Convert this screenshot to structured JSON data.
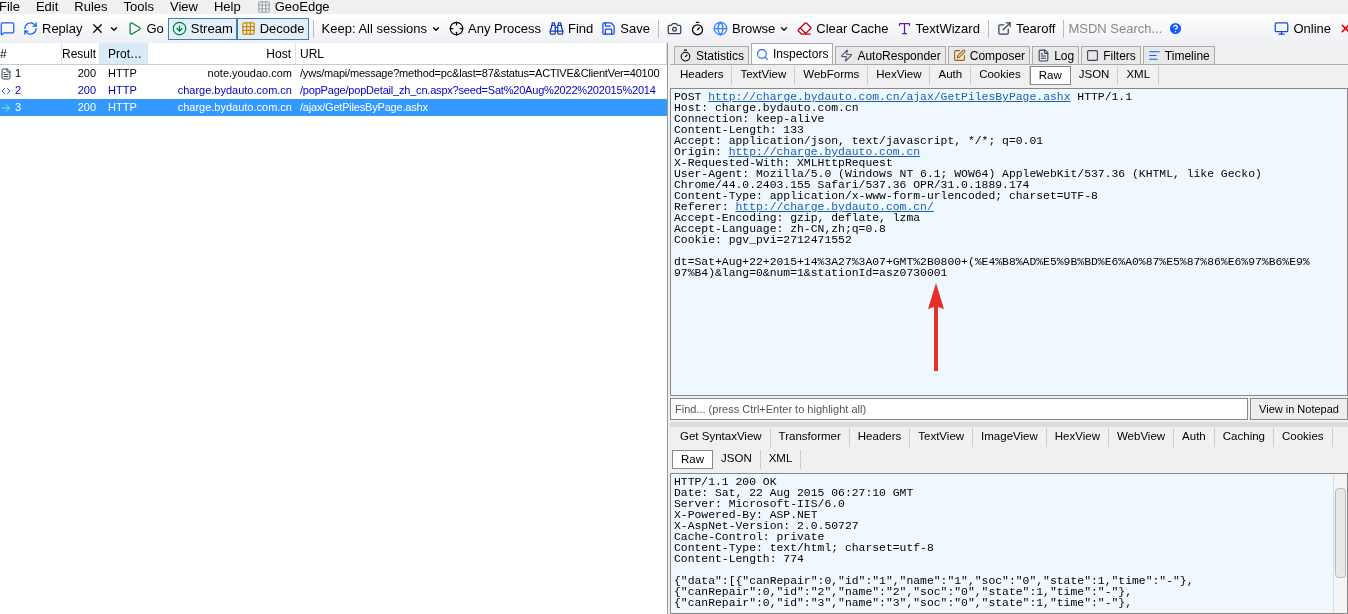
{
  "menu": [
    "File",
    "Edit",
    "Rules",
    "Tools",
    "View",
    "Help",
    "GeoEdge"
  ],
  "toolbar": [
    {
      "kind": "comment",
      "pressed": false
    },
    {
      "kind": "replay",
      "label": "Replay",
      "pressed": false
    },
    {
      "kind": "remove",
      "pressed": false
    },
    {
      "kind": "go",
      "label": "Go",
      "pressed": false
    },
    {
      "kind": "stream",
      "label": "Stream",
      "pressed": true
    },
    {
      "kind": "decode",
      "label": "Decode",
      "pressed": true
    },
    {
      "kind": "keep",
      "label": "Keep: All sessions",
      "pressed": false
    },
    {
      "kind": "process",
      "label": "Any Process",
      "pressed": false
    },
    {
      "kind": "find",
      "label": "Find",
      "pressed": false
    },
    {
      "kind": "save",
      "label": "Save",
      "pressed": false
    },
    {
      "kind": "camera",
      "pressed": false
    },
    {
      "kind": "timer",
      "pressed": false
    },
    {
      "kind": "browse",
      "label": "Browse",
      "pressed": false
    },
    {
      "kind": "clear",
      "label": "Clear Cache",
      "pressed": false
    },
    {
      "kind": "textwizard",
      "label": "TextWizard",
      "pressed": false
    },
    {
      "kind": "tearoff",
      "label": "Tearoff",
      "pressed": false
    }
  ],
  "msdn_search": {
    "placeholder": "MSDN Search..."
  },
  "online": "Online",
  "sessions": {
    "columns": [
      {
        "label": "#",
        "sorted": false
      },
      {
        "label": "Result",
        "sorted": false
      },
      {
        "label": "Prot…",
        "sorted": true
      },
      {
        "label": "Host",
        "sorted": false
      },
      {
        "label": "URL",
        "sorted": false
      }
    ],
    "rows": [
      {
        "kind": "document",
        "num": "1",
        "result": "200",
        "protocol": "HTTP",
        "host": "note.youdao.com",
        "url": "/yws/mapi/message?method=pc&last=87&status=ACTIVE&ClientVer=40100",
        "highlighted": false,
        "selected": false
      },
      {
        "kind": "arrows",
        "num": "2",
        "result": "200",
        "protocol": "HTTP",
        "host": "charge.bydauto.com.cn",
        "url": "/popPage/popDetail_zh_cn.aspx?seed=Sat%20Aug%2022%202015%2014",
        "highlighted": true,
        "selected": false
      },
      {
        "kind": "arrow",
        "num": "3",
        "result": "200",
        "protocol": "HTTP",
        "host": "charge.bydauto.com.cn",
        "url": "/ajax/GetPilesByPage.ashx",
        "highlighted": true,
        "selected": true
      }
    ]
  },
  "main_tabs": [
    {
      "kind": "statistics",
      "label": "Statistics",
      "selected": false
    },
    {
      "kind": "inspectors",
      "label": "Inspectors",
      "selected": true
    },
    {
      "kind": "autoresponder",
      "label": "AutoResponder",
      "selected": false
    },
    {
      "kind": "composer",
      "label": "Composer",
      "selected": false
    },
    {
      "kind": "log",
      "label": "Log",
      "selected": false
    },
    {
      "kind": "filters",
      "label": "Filters",
      "selected": false
    },
    {
      "kind": "timeline",
      "label": "Timeline",
      "selected": false
    }
  ],
  "request_tabs": [
    {
      "label": "Headers",
      "selected": false
    },
    {
      "label": "TextView",
      "selected": false
    },
    {
      "label": "WebForms",
      "selected": false
    },
    {
      "label": "HexView",
      "selected": false
    },
    {
      "label": "Auth",
      "selected": false
    },
    {
      "label": "Cookies",
      "selected": false
    },
    {
      "label": "Raw",
      "selected": true
    },
    {
      "label": "JSON",
      "selected": false
    },
    {
      "label": "XML",
      "selected": false
    }
  ],
  "request_lines": [
    [
      {
        "t": "POST "
      },
      {
        "t": "http://charge.bydauto.com.cn/ajax/GetPilesByPage.ashx",
        "link": true
      },
      {
        "t": " HTTP/1.1"
      }
    ],
    [
      {
        "t": "Host: charge.bydauto.com.cn"
      }
    ],
    [
      {
        "t": "Connection: keep-alive"
      }
    ],
    [
      {
        "t": "Content-Length: 133"
      }
    ],
    [
      {
        "t": "Accept: application/json, text/javascript, */*; q=0.01"
      }
    ],
    [
      {
        "t": "Origin: "
      },
      {
        "t": "http://charge.bydauto.com.cn",
        "link": true
      }
    ],
    [
      {
        "t": "X-Requested-With: XMLHttpRequest"
      }
    ],
    [
      {
        "t": "User-Agent: Mozilla/5.0 (Windows NT 6.1; WOW64) AppleWebKit/537.36 (KHTML, like Gecko)"
      }
    ],
    [
      {
        "t": "Chrome/44.0.2403.155 Safari/537.36 OPR/31.0.1889.174"
      }
    ],
    [
      {
        "t": "Content-Type: application/x-www-form-urlencoded; charset=UTF-8"
      }
    ],
    [
      {
        "t": "Referer: "
      },
      {
        "t": "http://charge.bydauto.com.cn/",
        "link": true
      }
    ],
    [
      {
        "t": "Accept-Encoding: gzip, deflate, lzma"
      }
    ],
    [
      {
        "t": "Accept-Language: zh-CN,zh;q=0.8"
      }
    ],
    [
      {
        "t": "Cookie: pgv_pvi=2712471552"
      }
    ]
  ],
  "request_body": [
    [
      {
        "t": "dt=Sat+Aug+22+2015+14%3A27%3A07+GMT%2B0800+(%E4%B8%AD%E5%9B%BD%E6%A0%87%E5%87%86%E6%97%B6%E9%"
      }
    ],
    [
      {
        "t": "97%B4)&lang=0&num=1&stationId=asz0730001"
      }
    ]
  ],
  "find": {
    "placeholder": "Find... (press Ctrl+Enter to highlight all)",
    "button": "View in Notepad"
  },
  "response_tabs": [
    {
      "label": "Get SyntaxView",
      "selected": false
    },
    {
      "label": "Transformer",
      "selected": false
    },
    {
      "label": "Headers",
      "selected": false
    },
    {
      "label": "TextView",
      "selected": false
    },
    {
      "label": "ImageView",
      "selected": false
    },
    {
      "label": "HexView",
      "selected": false
    },
    {
      "label": "WebView",
      "selected": false
    },
    {
      "label": "Auth",
      "selected": false
    },
    {
      "label": "Caching",
      "selected": false
    },
    {
      "label": "Cookies",
      "selected": false
    }
  ],
  "response_subtabs": [
    {
      "label": "Raw",
      "selected": true
    },
    {
      "label": "JSON",
      "selected": false
    },
    {
      "label": "XML",
      "selected": false
    }
  ],
  "response_lines": [
    "HTTP/1.1 200 OK",
    "Date: Sat, 22 Aug 2015 06:27:10 GMT",
    "Server: Microsoft-IIS/6.0",
    "X-Powered-By: ASP.NET",
    "X-AspNet-Version: 2.0.50727",
    "Cache-Control: private",
    "Content-Type: text/html; charset=utf-8",
    "Content-Length: 774"
  ],
  "response_body": [
    "{\"data\":[{\"canRepair\":0,\"id\":\"1\",\"name\":\"1\",\"soc\":\"0\",\"state\":1,\"time\":\"-\"},",
    "{\"canRepair\":0,\"id\":\"2\",\"name\":\"2\",\"soc\":\"0\",\"state\":1,\"time\":\"-\"},",
    "{\"canRepair\":0,\"id\":\"3\",\"name\":\"3\",\"soc\":\"0\",\"state\":1,\"time\":\"-\"},"
  ]
}
